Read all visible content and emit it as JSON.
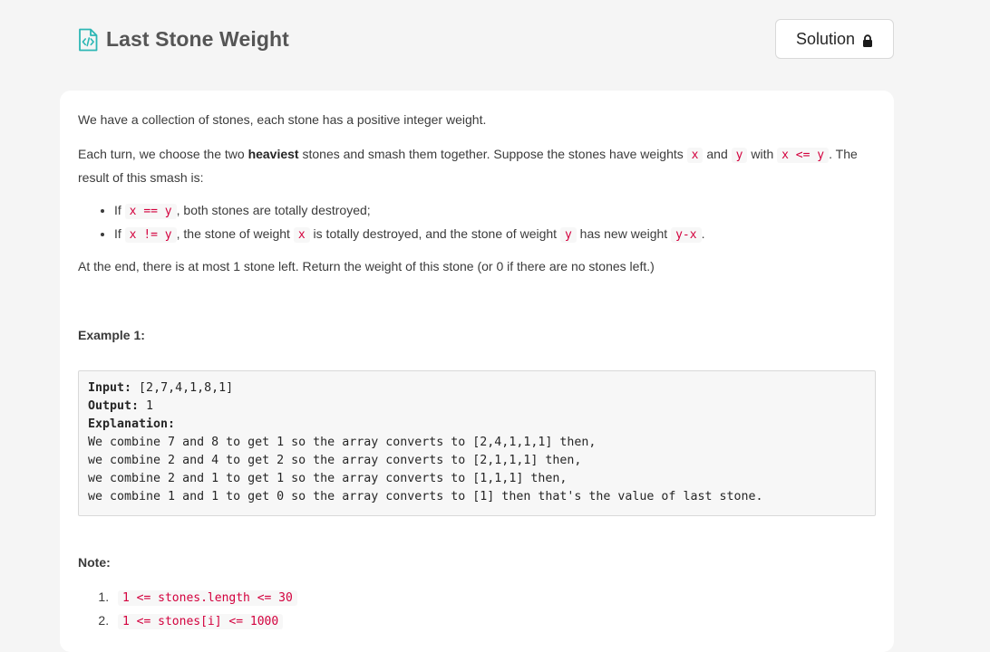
{
  "header": {
    "title": "Last Stone Weight",
    "solution_label": "Solution",
    "icon": "code-file-icon",
    "lock_icon": "lock-icon",
    "accent_color": "#2db7b5"
  },
  "problem": {
    "p1": "We have a collection of stones, each stone has a positive integer weight.",
    "p2_a": "Each turn, we choose the two ",
    "p2_bold": "heaviest",
    "p2_b": " stones and smash them together.  Suppose the stones have weights ",
    "p2_code_x": "x",
    "p2_and": " and ",
    "p2_code_y": "y",
    "p2_with": " with ",
    "p2_code_xy": "x <= y",
    "p2_c": ". The result of this smash is:",
    "rule1_if": "If ",
    "rule1_code": "x == y",
    "rule1_text": ", both stones are totally destroyed;",
    "rule2_if": "If ",
    "rule2_code": "x != y",
    "rule2_text_a": ", the stone of weight ",
    "rule2_code_x": "x",
    "rule2_text_b": " is totally destroyed, and the stone of weight ",
    "rule2_code_y": "y",
    "rule2_text_c": " has new weight ",
    "rule2_code_yx": "y-x",
    "rule2_text_d": ".",
    "p3": "At the end, there is at most 1 stone left.  Return the weight of this stone (or 0 if there are no stones left.)"
  },
  "example": {
    "heading": "Example 1:",
    "input_label": "Input:",
    "input_value": " [2,7,4,1,8,1]",
    "output_label": "Output:",
    "output_value": " 1",
    "explanation_label": "Explanation:",
    "lines": [
      "We combine 7 and 8 to get 1 so the array converts to [2,4,1,1,1] then,",
      "we combine 2 and 4 to get 2 so the array converts to [2,1,1,1] then,",
      "we combine 2 and 1 to get 1 so the array converts to [1,1,1] then,",
      "we combine 1 and 1 to get 0 so the array converts to [1] then that's the value of last stone."
    ]
  },
  "note": {
    "heading": "Note:",
    "constraints": [
      "1 <= stones.length <= 30",
      "1 <= stones[i] <= 1000"
    ]
  }
}
